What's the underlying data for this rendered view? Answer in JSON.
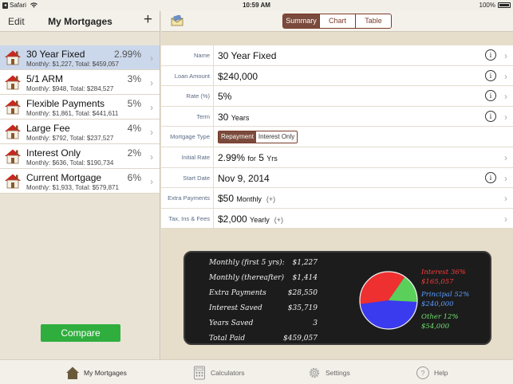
{
  "status": {
    "carrier": "Safari",
    "time": "10:59 AM",
    "battery": "100%"
  },
  "left": {
    "edit_label": "Edit",
    "title": "My Mortgages",
    "add_label": "+",
    "compare_label": "Compare",
    "mortgages": [
      {
        "name": "30 Year Fixed",
        "rate": "2.99%",
        "summary": "Monthly: $1,227, Total: $459,057",
        "selected": true
      },
      {
        "name": "5/1 ARM",
        "rate": "3%",
        "summary": "Monthly: $948, Total: $284,527",
        "selected": false
      },
      {
        "name": "Flexible Payments",
        "rate": "5%",
        "summary": "Monthly: $1,861, Total: $441,611",
        "selected": false
      },
      {
        "name": "Large Fee",
        "rate": "4%",
        "summary": "Monthly: $792, Total: $237,527",
        "selected": false
      },
      {
        "name": "Interest Only",
        "rate": "2%",
        "summary": "Monthly: $636, Total: $190,734",
        "selected": false
      },
      {
        "name": "Current Mortgage",
        "rate": "6%",
        "summary": "Monthly: $1,933, Total: $579,871",
        "selected": false
      }
    ]
  },
  "right": {
    "segments": [
      "Summary",
      "Chart",
      "Table"
    ],
    "active_segment": "Summary",
    "fields": {
      "name": {
        "label": "Name",
        "value": "30 Year Fixed"
      },
      "loan_amount": {
        "label": "Loan Amount",
        "value": "$240,000"
      },
      "rate": {
        "label": "Rate (%)",
        "value": "5%"
      },
      "term": {
        "label": "Term",
        "value": "30",
        "unit": "Years"
      },
      "mortgage_type": {
        "label": "Mortgage Type",
        "options": [
          "Repayment",
          "Interest Only"
        ],
        "selected": "Repayment"
      },
      "initial_rate": {
        "label": "Initial Rate",
        "value": "2.99%",
        "for_label": "for",
        "years": "5",
        "unit": "Yrs"
      },
      "start_date": {
        "label": "Start Date",
        "value": "Nov 9, 2014"
      },
      "extra_payments": {
        "label": "Extra Payments",
        "value": "$50",
        "unit": "Monthly",
        "add": "(+)"
      },
      "tax_fees": {
        "label": "Tax, Ins & Fees",
        "value": "$2,000",
        "unit": "Yearly",
        "add": "(+)"
      }
    },
    "info_glyph": "i",
    "chevron_glyph": "›"
  },
  "summary_board": {
    "rows": [
      {
        "label": "Monthly (first 5 yrs):",
        "value": "$1,227"
      },
      {
        "label": "Monthly (thereafter)",
        "value": "$1,414"
      },
      {
        "label": "Extra Payments",
        "value": "$28,550"
      },
      {
        "label": "Interest Saved",
        "value": "$35,719"
      },
      {
        "label": "Years Saved",
        "value": "3"
      },
      {
        "label": "Total Paid",
        "value": "$459,057"
      }
    ],
    "legend": [
      {
        "label": "Interest 36%",
        "value": "$165,057",
        "color": "#ff3b3b"
      },
      {
        "label": "Principal 52%",
        "value": "$240,000",
        "color": "#5b9cff"
      },
      {
        "label": "Other 12%",
        "value": "$54,000",
        "color": "#6ee06e"
      }
    ]
  },
  "tabs": [
    {
      "label": "My Mortgages",
      "icon": "house-icon",
      "active": true
    },
    {
      "label": "Calculators",
      "icon": "calculator-icon",
      "active": false
    },
    {
      "label": "Settings",
      "icon": "gear-icon",
      "active": false
    },
    {
      "label": "Help",
      "icon": "help-icon",
      "active": false
    }
  ]
}
